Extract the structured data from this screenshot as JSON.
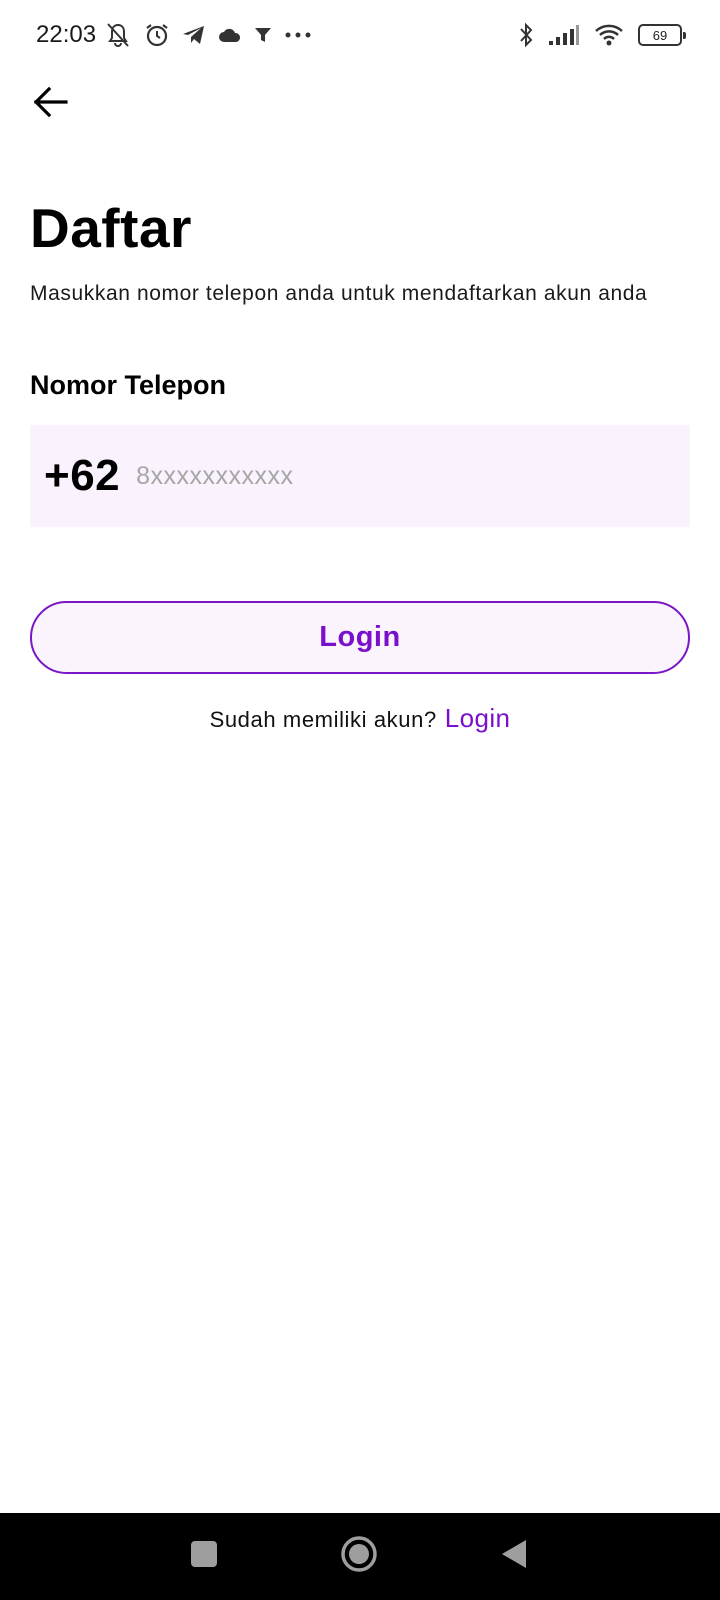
{
  "status_bar": {
    "time": "22:03",
    "battery_level": "69",
    "left_icons": [
      "mute-icon",
      "alarm-icon",
      "telegram-icon",
      "cloud-icon",
      "filter-icon",
      "more-icon"
    ],
    "right_icons": [
      "bluetooth-icon",
      "signal-icon",
      "wifi-icon",
      "battery-icon"
    ]
  },
  "header": {
    "back_icon": "arrow-left-icon",
    "title": "Daftar",
    "subtitle": "Masukkan nomor telepon anda untuk mendaftarkan akun anda"
  },
  "form": {
    "phone_label": "Nomor Telepon",
    "country_code": "+62",
    "phone_placeholder": "8xxxxxxxxxxx",
    "phone_value": "",
    "submit_label": "Login"
  },
  "footer": {
    "prompt": "Sudah memiliki akun?",
    "link": "Login"
  },
  "nav_bar": {
    "buttons": [
      "recents-icon",
      "home-icon",
      "back-triangle-icon"
    ]
  },
  "colors": {
    "accent": "#7a10cc",
    "field_bg": "#faf3fd",
    "button_bg": "#fbf4fd",
    "nav_bg": "#000000"
  }
}
